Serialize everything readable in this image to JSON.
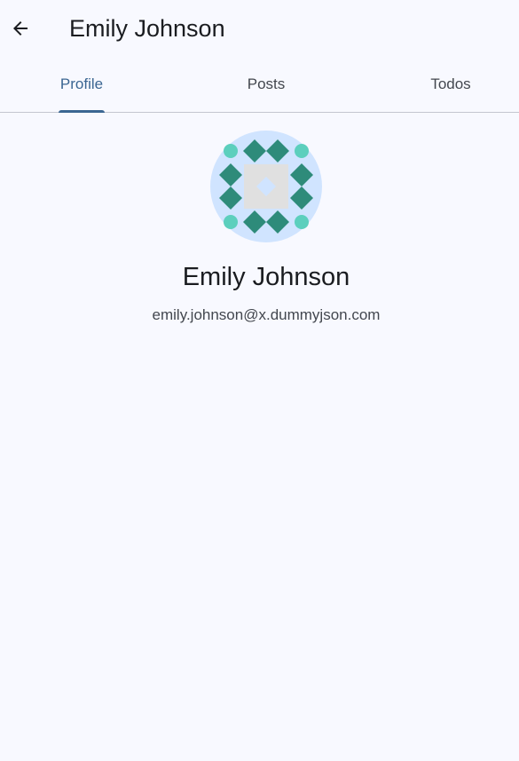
{
  "header": {
    "title": "Emily Johnson",
    "back_icon": "arrow-back-icon"
  },
  "tabs": [
    {
      "label": "Profile",
      "active": true
    },
    {
      "label": "Posts",
      "active": false
    },
    {
      "label": "Todos",
      "active": false
    }
  ],
  "profile": {
    "avatar_icon": "identicon-avatar",
    "name": "Emily Johnson",
    "email": "emily.johnson@x.dummyjson.com"
  },
  "colors": {
    "background": "#f8f9ff",
    "accent": "#3b6692",
    "avatar_bg": "#d0e4ff",
    "identicon_dark": "#2e8b7a",
    "identicon_light": "#5ccfbd",
    "identicon_gray": "#e0e0e0"
  }
}
